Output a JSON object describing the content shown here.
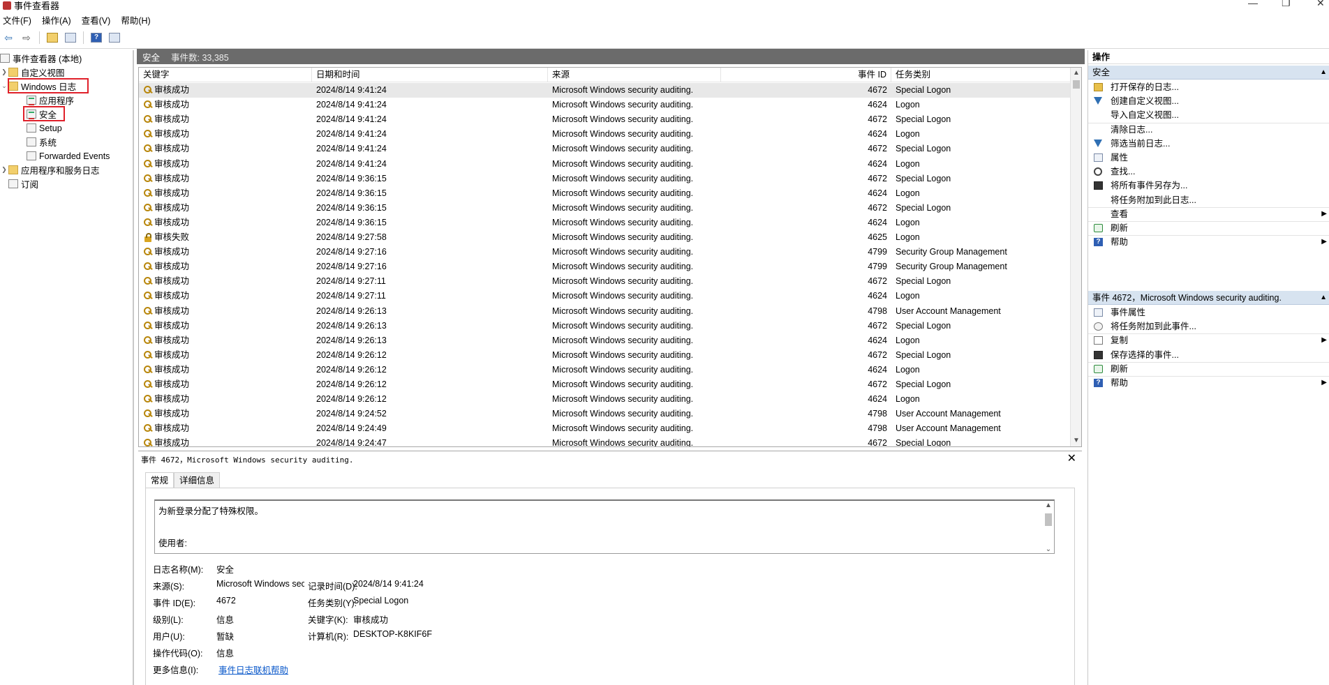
{
  "window": {
    "title": "事件查看器",
    "minimize": "—",
    "restore": "❐",
    "close": "✕"
  },
  "menu": [
    "文件(F)",
    "操作(A)",
    "查看(V)",
    "帮助(H)"
  ],
  "toolbar": {
    "back": "⇦",
    "forward": "⇨",
    "help": "?"
  },
  "tree": {
    "root": "事件查看器 (本地)",
    "custom_views": "自定义视图",
    "windows_logs": "Windows 日志",
    "application": "应用程序",
    "security": "安全",
    "setup": "Setup",
    "system": "系统",
    "forwarded": "Forwarded Events",
    "app_service_logs": "应用程序和服务日志",
    "subscriptions": "订阅"
  },
  "center": {
    "log_name": "安全",
    "event_count": "事件数: 33,385",
    "columns": {
      "keyword": "关键字",
      "datetime": "日期和时间",
      "source": "来源",
      "event_id": "事件 ID",
      "task": "任务类别"
    },
    "rows": [
      {
        "icon": "key",
        "keyword": "审核成功",
        "datetime": "2024/8/14 9:41:24",
        "source": "Microsoft Windows security auditing.",
        "id": "4672",
        "task": "Special Logon"
      },
      {
        "icon": "key",
        "keyword": "审核成功",
        "datetime": "2024/8/14 9:41:24",
        "source": "Microsoft Windows security auditing.",
        "id": "4624",
        "task": "Logon"
      },
      {
        "icon": "key",
        "keyword": "审核成功",
        "datetime": "2024/8/14 9:41:24",
        "source": "Microsoft Windows security auditing.",
        "id": "4672",
        "task": "Special Logon"
      },
      {
        "icon": "key",
        "keyword": "审核成功",
        "datetime": "2024/8/14 9:41:24",
        "source": "Microsoft Windows security auditing.",
        "id": "4624",
        "task": "Logon"
      },
      {
        "icon": "key",
        "keyword": "审核成功",
        "datetime": "2024/8/14 9:41:24",
        "source": "Microsoft Windows security auditing.",
        "id": "4672",
        "task": "Special Logon"
      },
      {
        "icon": "key",
        "keyword": "审核成功",
        "datetime": "2024/8/14 9:41:24",
        "source": "Microsoft Windows security auditing.",
        "id": "4624",
        "task": "Logon"
      },
      {
        "icon": "key",
        "keyword": "审核成功",
        "datetime": "2024/8/14 9:36:15",
        "source": "Microsoft Windows security auditing.",
        "id": "4672",
        "task": "Special Logon"
      },
      {
        "icon": "key",
        "keyword": "审核成功",
        "datetime": "2024/8/14 9:36:15",
        "source": "Microsoft Windows security auditing.",
        "id": "4624",
        "task": "Logon"
      },
      {
        "icon": "key",
        "keyword": "审核成功",
        "datetime": "2024/8/14 9:36:15",
        "source": "Microsoft Windows security auditing.",
        "id": "4672",
        "task": "Special Logon"
      },
      {
        "icon": "key",
        "keyword": "审核成功",
        "datetime": "2024/8/14 9:36:15",
        "source": "Microsoft Windows security auditing.",
        "id": "4624",
        "task": "Logon"
      },
      {
        "icon": "lock",
        "keyword": "审核失败",
        "datetime": "2024/8/14 9:27:58",
        "source": "Microsoft Windows security auditing.",
        "id": "4625",
        "task": "Logon"
      },
      {
        "icon": "key",
        "keyword": "审核成功",
        "datetime": "2024/8/14 9:27:16",
        "source": "Microsoft Windows security auditing.",
        "id": "4799",
        "task": "Security Group Management"
      },
      {
        "icon": "key",
        "keyword": "审核成功",
        "datetime": "2024/8/14 9:27:16",
        "source": "Microsoft Windows security auditing.",
        "id": "4799",
        "task": "Security Group Management"
      },
      {
        "icon": "key",
        "keyword": "审核成功",
        "datetime": "2024/8/14 9:27:11",
        "source": "Microsoft Windows security auditing.",
        "id": "4672",
        "task": "Special Logon"
      },
      {
        "icon": "key",
        "keyword": "审核成功",
        "datetime": "2024/8/14 9:27:11",
        "source": "Microsoft Windows security auditing.",
        "id": "4624",
        "task": "Logon"
      },
      {
        "icon": "key",
        "keyword": "审核成功",
        "datetime": "2024/8/14 9:26:13",
        "source": "Microsoft Windows security auditing.",
        "id": "4798",
        "task": "User Account Management"
      },
      {
        "icon": "key",
        "keyword": "审核成功",
        "datetime": "2024/8/14 9:26:13",
        "source": "Microsoft Windows security auditing.",
        "id": "4672",
        "task": "Special Logon"
      },
      {
        "icon": "key",
        "keyword": "审核成功",
        "datetime": "2024/8/14 9:26:13",
        "source": "Microsoft Windows security auditing.",
        "id": "4624",
        "task": "Logon"
      },
      {
        "icon": "key",
        "keyword": "审核成功",
        "datetime": "2024/8/14 9:26:12",
        "source": "Microsoft Windows security auditing.",
        "id": "4672",
        "task": "Special Logon"
      },
      {
        "icon": "key",
        "keyword": "审核成功",
        "datetime": "2024/8/14 9:26:12",
        "source": "Microsoft Windows security auditing.",
        "id": "4624",
        "task": "Logon"
      },
      {
        "icon": "key",
        "keyword": "审核成功",
        "datetime": "2024/8/14 9:26:12",
        "source": "Microsoft Windows security auditing.",
        "id": "4672",
        "task": "Special Logon"
      },
      {
        "icon": "key",
        "keyword": "审核成功",
        "datetime": "2024/8/14 9:26:12",
        "source": "Microsoft Windows security auditing.",
        "id": "4624",
        "task": "Logon"
      },
      {
        "icon": "key",
        "keyword": "审核成功",
        "datetime": "2024/8/14 9:24:52",
        "source": "Microsoft Windows security auditing.",
        "id": "4798",
        "task": "User Account Management"
      },
      {
        "icon": "key",
        "keyword": "审核成功",
        "datetime": "2024/8/14 9:24:49",
        "source": "Microsoft Windows security auditing.",
        "id": "4798",
        "task": "User Account Management"
      },
      {
        "icon": "key",
        "keyword": "审核成功",
        "datetime": "2024/8/14 9:24:47",
        "source": "Microsoft Windows security auditing.",
        "id": "4672",
        "task": "Special Logon"
      }
    ]
  },
  "detail": {
    "title": "事件 4672，Microsoft Windows security auditing.",
    "close": "✕",
    "tab_general": "常规",
    "tab_details": "详细信息",
    "description_line1": "为新登录分配了特殊权限。",
    "description_line2": "使用者:",
    "labels": {
      "log_name": "日志名称(M):",
      "source": "来源(S):",
      "event_id": "事件 ID(E):",
      "level": "级别(L):",
      "user": "用户(U):",
      "opcode": "操作代码(O):",
      "more_info": "更多信息(I):",
      "logged": "记录时间(D):",
      "task": "任务类别(Y):",
      "keywords": "关键字(K):",
      "computer": "计算机(R):"
    },
    "values": {
      "log_name": "安全",
      "source": "Microsoft Windows secur",
      "event_id": "4672",
      "level": "信息",
      "user": "暂缺",
      "opcode": "信息",
      "more_info": "事件日志联机帮助",
      "logged": "2024/8/14 9:41:24",
      "task": "Special Logon",
      "keywords": "审核成功",
      "computer": "DESKTOP-K8KIF6F"
    }
  },
  "actions": {
    "header": "操作",
    "section1": "安全",
    "section1_items": [
      {
        "icon": "open",
        "label": "打开保存的日志..."
      },
      {
        "icon": "filter",
        "label": "创建自定义视图..."
      },
      {
        "icon": "none",
        "label": "导入自定义视图..."
      },
      {
        "icon": "none",
        "label": "清除日志..."
      },
      {
        "icon": "filter",
        "label": "筛选当前日志..."
      },
      {
        "icon": "props",
        "label": "属性"
      },
      {
        "icon": "find",
        "label": "查找..."
      },
      {
        "icon": "save",
        "label": "将所有事件另存为..."
      },
      {
        "icon": "none",
        "label": "将任务附加到此日志..."
      },
      {
        "icon": "none",
        "label": "查看",
        "sub": "▶"
      },
      {
        "icon": "refresh",
        "label": "刷新"
      },
      {
        "icon": "help",
        "label": "帮助",
        "sub": "▶"
      }
    ],
    "section2": "事件 4672，Microsoft Windows security auditing.",
    "section2_items": [
      {
        "icon": "props",
        "label": "事件属性"
      },
      {
        "icon": "task",
        "label": "将任务附加到此事件..."
      },
      {
        "icon": "copy",
        "label": "复制",
        "sub": "▶"
      },
      {
        "icon": "save",
        "label": "保存选择的事件..."
      },
      {
        "icon": "refresh",
        "label": "刷新"
      },
      {
        "icon": "help",
        "label": "帮助",
        "sub": "▶"
      }
    ],
    "caret": "▲"
  }
}
